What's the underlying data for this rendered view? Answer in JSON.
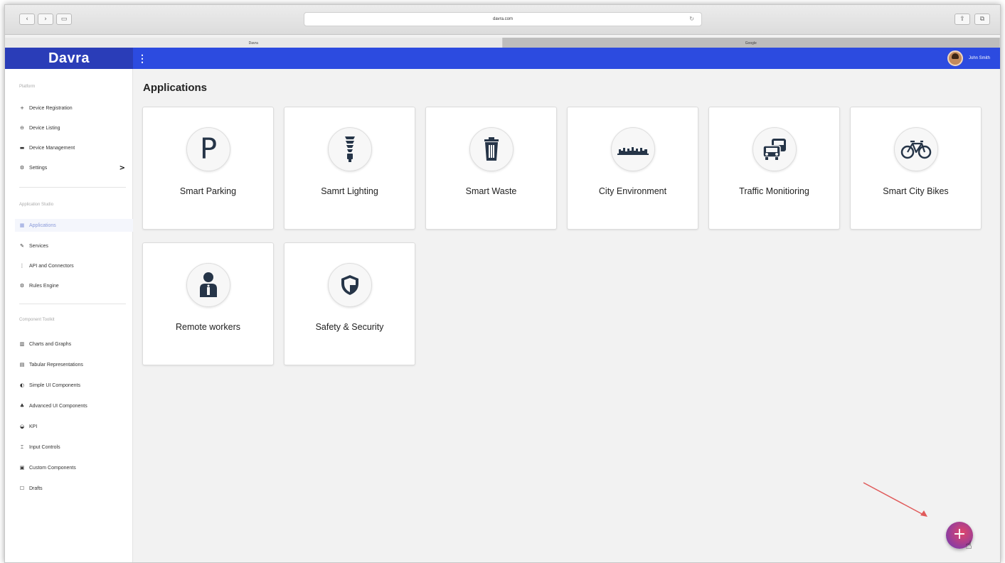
{
  "browser": {
    "url": "davra.com",
    "tabs": [
      {
        "label": "Davra",
        "active": true
      },
      {
        "label": "Google",
        "active": false
      }
    ]
  },
  "app": {
    "brand": "Davra",
    "brand_color": "#2a3db8",
    "header_color": "#2c4be0",
    "user_name": "John Smith"
  },
  "sidebar": {
    "sections": [
      {
        "title": "Platform",
        "items": [
          {
            "label": "Device Registration",
            "icon": "plus-icon"
          },
          {
            "label": "Device Listing",
            "icon": "link-icon"
          },
          {
            "label": "Device Management",
            "icon": "server-icon"
          },
          {
            "label": "Settings",
            "icon": "sliders-icon",
            "chevron": ">"
          }
        ]
      },
      {
        "title": "Application Studio",
        "items": [
          {
            "label": "Applications",
            "icon": "grid-icon",
            "active": true
          },
          {
            "label": "Services",
            "icon": "wrench-icon"
          },
          {
            "label": "API and Connectors",
            "icon": "plug-icon"
          },
          {
            "label": "Rules Engine",
            "icon": "sliders-icon"
          }
        ]
      },
      {
        "title": "Component Toolkit",
        "items": [
          {
            "label": "Charts and Graphs",
            "icon": "bar-chart-icon"
          },
          {
            "label": "Tabular Representations",
            "icon": "table-icon"
          },
          {
            "label": "Simple UI Components",
            "icon": "puzzle-icon"
          },
          {
            "label": "Advanced UI Components",
            "icon": "cubes-icon"
          },
          {
            "label": "KPI",
            "icon": "dashboard-icon"
          },
          {
            "label": "Input Controls",
            "icon": "cursor-icon"
          },
          {
            "label": "Custom Components",
            "icon": "gift-icon"
          },
          {
            "label": "Drafts",
            "icon": "edit-icon"
          }
        ]
      }
    ]
  },
  "main": {
    "title": "Applications",
    "apps": [
      {
        "label": "Smart Parking",
        "icon": "parking-icon"
      },
      {
        "label": "Samrt Lighting",
        "icon": "bulb-icon"
      },
      {
        "label": "Smart Waste",
        "icon": "trash-icon"
      },
      {
        "label": "City Environment",
        "icon": "cityscape-icon"
      },
      {
        "label": "Traffic Monitioring",
        "icon": "traffic-icon"
      },
      {
        "label": "Smart City Bikes",
        "icon": "bicycle-icon"
      },
      {
        "label": "Remote workers",
        "icon": "worker-icon"
      },
      {
        "label": "Safety & Security",
        "icon": "shield-icon"
      }
    ],
    "fab_label": "+"
  }
}
